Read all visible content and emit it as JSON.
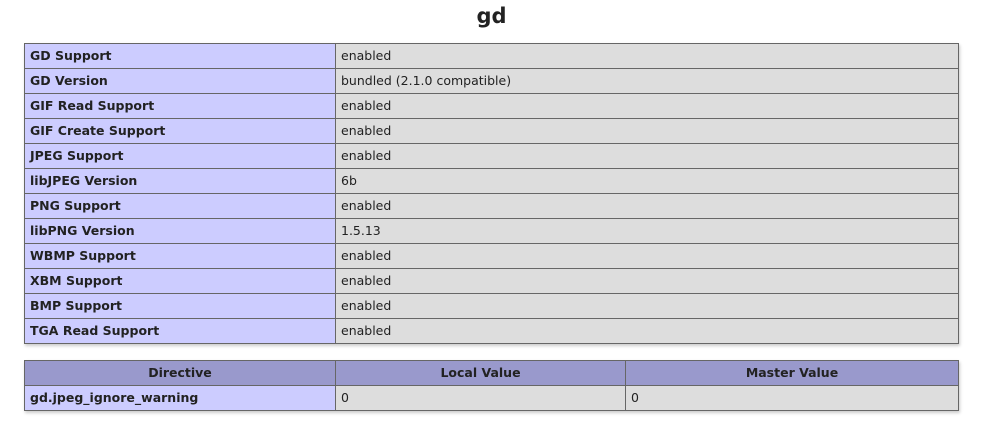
{
  "title": "gd",
  "info_rows": [
    {
      "label": "GD Support",
      "value": "enabled"
    },
    {
      "label": "GD Version",
      "value": "bundled (2.1.0 compatible)"
    },
    {
      "label": "GIF Read Support",
      "value": "enabled"
    },
    {
      "label": "GIF Create Support",
      "value": "enabled"
    },
    {
      "label": "JPEG Support",
      "value": "enabled"
    },
    {
      "label": "libJPEG Version",
      "value": "6b"
    },
    {
      "label": "PNG Support",
      "value": "enabled"
    },
    {
      "label": "libPNG Version",
      "value": "1.5.13"
    },
    {
      "label": "WBMP Support",
      "value": "enabled"
    },
    {
      "label": "XBM Support",
      "value": "enabled"
    },
    {
      "label": "BMP Support",
      "value": "enabled"
    },
    {
      "label": "TGA Read Support",
      "value": "enabled"
    }
  ],
  "directives": {
    "headers": {
      "directive": "Directive",
      "local": "Local Value",
      "master": "Master Value"
    },
    "rows": [
      {
        "name": "gd.jpeg_ignore_warning",
        "local": "0",
        "master": "0"
      }
    ]
  },
  "colors": {
    "label_cell": "#ccccff",
    "value_cell": "#dddddd",
    "header_cell": "#9999cc",
    "border": "#666666"
  }
}
